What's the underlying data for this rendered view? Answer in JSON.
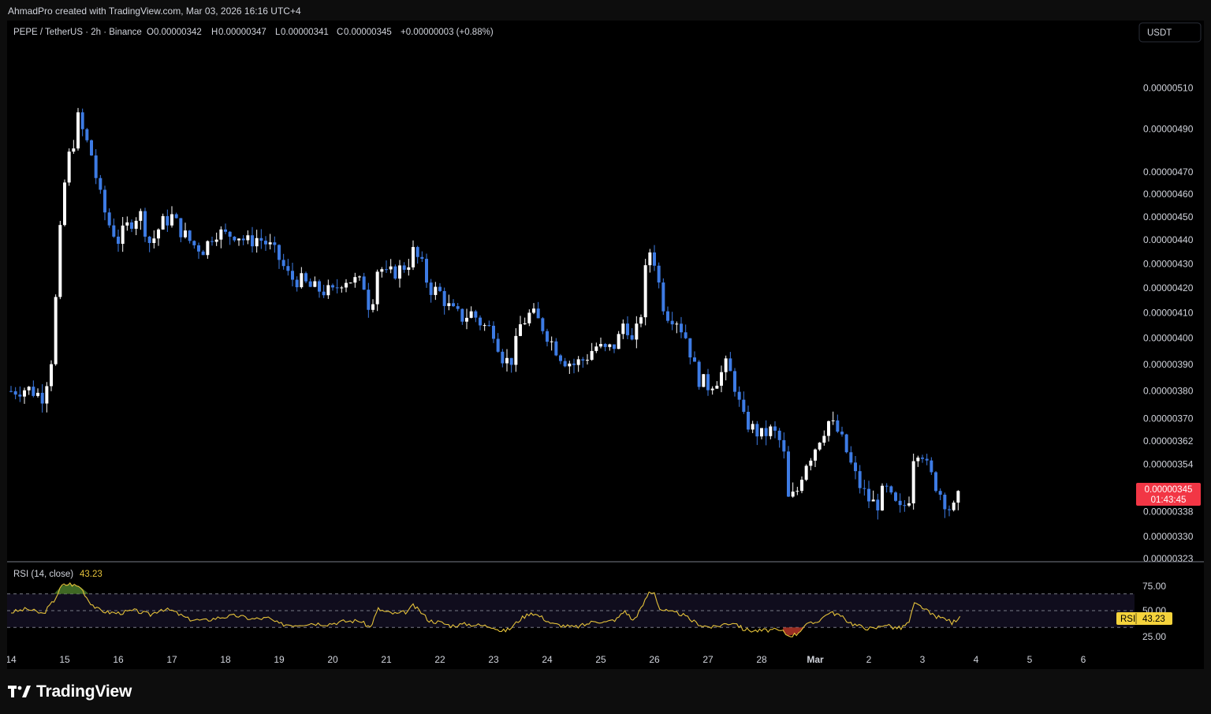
{
  "header": {
    "credit": "AhmadPro created with TradingView.com, Mar 03, 2026 16:16 UTC+4"
  },
  "legend": {
    "symbol": "PEPE / TetherUS · 2h · Binance",
    "o_label": "O",
    "o_value": "0.00000342",
    "h_label": "H",
    "h_value": "0.00000347",
    "l_label": "L",
    "l_value": "0.00000341",
    "c_label": "C",
    "c_value": "0.00000345",
    "change": "+0.00000003 (+0.88%)"
  },
  "currency_button": "USDT",
  "price_badge": {
    "price": "0.00000345",
    "countdown": "01:43:45"
  },
  "rsi": {
    "label": "RSI (14, close)",
    "value": "43.23",
    "badge_label": "RSI",
    "badge_value": "43.23",
    "levels": [
      "75.00",
      "50.00",
      "25.00"
    ]
  },
  "footer": {
    "brand": "TradingView"
  },
  "colors": {
    "up": "#ffffff",
    "down": "#3d7be4",
    "rsi_line": "#e5c23a",
    "overbought_fill": "#4a7a2a",
    "oversold_fill": "#c0392b",
    "price_badge": "#f23645",
    "rsi_badge": "#f5d33c"
  },
  "chart_data": {
    "type": "candlestick",
    "y_scale": "log",
    "ylim": [
      3.23e-06,
      5.22e-06
    ],
    "yticks": [
      "0.00000510",
      "0.00000490",
      "0.00000470",
      "0.00000460",
      "0.00000450",
      "0.00000440",
      "0.00000430",
      "0.00000420",
      "0.00000410",
      "0.00000400",
      "0.00000390",
      "0.00000380",
      "0.00000370",
      "0.00000362",
      "0.00000354",
      "0.00000338",
      "0.00000330",
      "0.00000323"
    ],
    "xticks": [
      "14",
      "15",
      "16",
      "17",
      "18",
      "19",
      "20",
      "21",
      "22",
      "23",
      "24",
      "25",
      "26",
      "27",
      "28",
      "Mar",
      "2",
      "3",
      "4",
      "5",
      "6"
    ],
    "close_path": [
      [
        14.0,
        3.8e-06
      ],
      [
        14.3,
        3.81e-06
      ],
      [
        14.6,
        3.78e-06
      ],
      [
        14.75,
        3.92e-06
      ],
      [
        14.85,
        4.2e-06
      ],
      [
        14.95,
        4.55e-06
      ],
      [
        15.05,
        4.75e-06
      ],
      [
        15.15,
        4.82e-06
      ],
      [
        15.25,
        4.95e-06
      ],
      [
        15.35,
        4.88e-06
      ],
      [
        15.5,
        4.78e-06
      ],
      [
        15.65,
        4.6e-06
      ],
      [
        15.8,
        4.48e-06
      ],
      [
        16.0,
        4.4e-06
      ],
      [
        16.2,
        4.47e-06
      ],
      [
        16.4,
        4.52e-06
      ],
      [
        16.6,
        4.38e-06
      ],
      [
        16.8,
        4.47e-06
      ],
      [
        17.0,
        4.5e-06
      ],
      [
        17.2,
        4.43e-06
      ],
      [
        17.4,
        4.38e-06
      ],
      [
        17.6,
        4.36e-06
      ],
      [
        17.8,
        4.44e-06
      ],
      [
        18.0,
        4.42e-06
      ],
      [
        18.2,
        4.43e-06
      ],
      [
        18.4,
        4.39e-06
      ],
      [
        18.6,
        4.41e-06
      ],
      [
        18.8,
        4.38e-06
      ],
      [
        19.0,
        4.32e-06
      ],
      [
        19.2,
        4.24e-06
      ],
      [
        19.4,
        4.23e-06
      ],
      [
        19.6,
        4.2e-06
      ],
      [
        19.8,
        4.19e-06
      ],
      [
        20.0,
        4.18e-06
      ],
      [
        20.2,
        4.24e-06
      ],
      [
        20.4,
        4.23e-06
      ],
      [
        20.6,
        4.21e-06
      ],
      [
        20.7,
        4.1e-06
      ],
      [
        20.85,
        4.3e-06
      ],
      [
        21.0,
        4.25e-06
      ],
      [
        21.2,
        4.27e-06
      ],
      [
        21.4,
        4.3e-06
      ],
      [
        21.5,
        4.35e-06
      ],
      [
        21.65,
        4.3e-06
      ],
      [
        21.8,
        4.2e-06
      ],
      [
        22.0,
        4.18e-06
      ],
      [
        22.2,
        4.11e-06
      ],
      [
        22.4,
        4.08e-06
      ],
      [
        22.6,
        4.1e-06
      ],
      [
        22.8,
        4.05e-06
      ],
      [
        23.0,
        4.03e-06
      ],
      [
        23.2,
        3.91e-06
      ],
      [
        23.35,
        3.92e-06
      ],
      [
        23.5,
        4.05e-06
      ],
      [
        23.7,
        4.1e-06
      ],
      [
        23.9,
        4.05e-06
      ],
      [
        24.1,
        3.98e-06
      ],
      [
        24.3,
        3.92e-06
      ],
      [
        24.5,
        3.9e-06
      ],
      [
        24.7,
        3.92e-06
      ],
      [
        24.9,
        3.97e-06
      ],
      [
        25.1,
        3.95e-06
      ],
      [
        25.3,
        3.98e-06
      ],
      [
        25.45,
        4.08e-06
      ],
      [
        25.6,
        3.97e-06
      ],
      [
        25.75,
        4.1e-06
      ],
      [
        25.85,
        4.3e-06
      ],
      [
        25.95,
        4.38e-06
      ],
      [
        26.05,
        4.25e-06
      ],
      [
        26.2,
        4.1e-06
      ],
      [
        26.4,
        4.08e-06
      ],
      [
        26.6,
        4e-06
      ],
      [
        26.8,
        3.85e-06
      ],
      [
        27.0,
        3.82e-06
      ],
      [
        27.2,
        3.85e-06
      ],
      [
        27.35,
        3.9e-06
      ],
      [
        27.5,
        3.82e-06
      ],
      [
        27.65,
        3.7e-06
      ],
      [
        27.85,
        3.66e-06
      ],
      [
        28.0,
        3.64e-06
      ],
      [
        28.2,
        3.66e-06
      ],
      [
        28.4,
        3.6e-06
      ],
      [
        28.5,
        3.42e-06
      ],
      [
        28.65,
        3.44e-06
      ],
      [
        28.8,
        3.54e-06
      ],
      [
        28.95,
        3.58e-06
      ],
      [
        29.1,
        3.64e-06
      ],
      [
        29.25,
        3.69e-06
      ],
      [
        29.4,
        3.66e-06
      ],
      [
        29.55,
        3.6e-06
      ],
      [
        29.7,
        3.52e-06
      ],
      [
        29.85,
        3.46e-06
      ],
      [
        30.0,
        3.42e-06
      ],
      [
        30.15,
        3.4e-06
      ],
      [
        30.3,
        3.46e-06
      ],
      [
        30.45,
        3.41e-06
      ],
      [
        30.6,
        3.38e-06
      ],
      [
        30.75,
        3.43e-06
      ],
      [
        30.85,
        3.6e-06
      ],
      [
        31.0,
        3.58e-06
      ],
      [
        31.1,
        3.52e-06
      ],
      [
        31.25,
        3.47e-06
      ],
      [
        31.4,
        3.42e-06
      ],
      [
        31.55,
        3.38e-06
      ],
      [
        31.65,
        3.41e-06
      ],
      [
        31.7,
        3.45e-06
      ]
    ],
    "rsi_series": [
      [
        14.0,
        48
      ],
      [
        14.3,
        52
      ],
      [
        14.6,
        46
      ],
      [
        14.8,
        62
      ],
      [
        14.95,
        80
      ],
      [
        15.1,
        82
      ],
      [
        15.3,
        78
      ],
      [
        15.45,
        62
      ],
      [
        15.6,
        52
      ],
      [
        15.8,
        48
      ],
      [
        16.0,
        47
      ],
      [
        16.3,
        50
      ],
      [
        16.6,
        45
      ],
      [
        16.8,
        52
      ],
      [
        17.0,
        50
      ],
      [
        17.3,
        40
      ],
      [
        17.6,
        38
      ],
      [
        17.9,
        42
      ],
      [
        18.2,
        44
      ],
      [
        18.5,
        40
      ],
      [
        18.8,
        41
      ],
      [
        19.0,
        34
      ],
      [
        19.3,
        33
      ],
      [
        19.6,
        35
      ],
      [
        19.9,
        34
      ],
      [
        20.2,
        37
      ],
      [
        20.5,
        38
      ],
      [
        20.7,
        30
      ],
      [
        20.85,
        52
      ],
      [
        21.0,
        48
      ],
      [
        21.2,
        46
      ],
      [
        21.4,
        49
      ],
      [
        21.5,
        56
      ],
      [
        21.65,
        48
      ],
      [
        21.8,
        38
      ],
      [
        22.0,
        36
      ],
      [
        22.2,
        32
      ],
      [
        22.5,
        34
      ],
      [
        22.8,
        32
      ],
      [
        23.0,
        31
      ],
      [
        23.15,
        25
      ],
      [
        23.3,
        28
      ],
      [
        23.5,
        40
      ],
      [
        23.7,
        48
      ],
      [
        23.9,
        42
      ],
      [
        24.1,
        34
      ],
      [
        24.3,
        32
      ],
      [
        24.5,
        30
      ],
      [
        24.7,
        33
      ],
      [
        24.9,
        38
      ],
      [
        25.1,
        36
      ],
      [
        25.3,
        40
      ],
      [
        25.45,
        50
      ],
      [
        25.6,
        38
      ],
      [
        25.75,
        52
      ],
      [
        25.9,
        72
      ],
      [
        26.0,
        72
      ],
      [
        26.1,
        52
      ],
      [
        26.3,
        48
      ],
      [
        26.5,
        46
      ],
      [
        26.7,
        38
      ],
      [
        26.9,
        32
      ],
      [
        27.1,
        30
      ],
      [
        27.3,
        34
      ],
      [
        27.5,
        36
      ],
      [
        27.65,
        28
      ],
      [
        27.85,
        26
      ],
      [
        28.0,
        26
      ],
      [
        28.2,
        27
      ],
      [
        28.4,
        25
      ],
      [
        28.5,
        20
      ],
      [
        28.65,
        22
      ],
      [
        28.8,
        32
      ],
      [
        29.0,
        36
      ],
      [
        29.15,
        42
      ],
      [
        29.25,
        48
      ],
      [
        29.4,
        46
      ],
      [
        29.55,
        40
      ],
      [
        29.7,
        34
      ],
      [
        29.9,
        30
      ],
      [
        30.1,
        28
      ],
      [
        30.3,
        34
      ],
      [
        30.45,
        30
      ],
      [
        30.6,
        29
      ],
      [
        30.75,
        36
      ],
      [
        30.85,
        58
      ],
      [
        31.0,
        54
      ],
      [
        31.15,
        46
      ],
      [
        31.3,
        42
      ],
      [
        31.45,
        40
      ],
      [
        31.55,
        35
      ],
      [
        31.7,
        43.23
      ]
    ]
  }
}
